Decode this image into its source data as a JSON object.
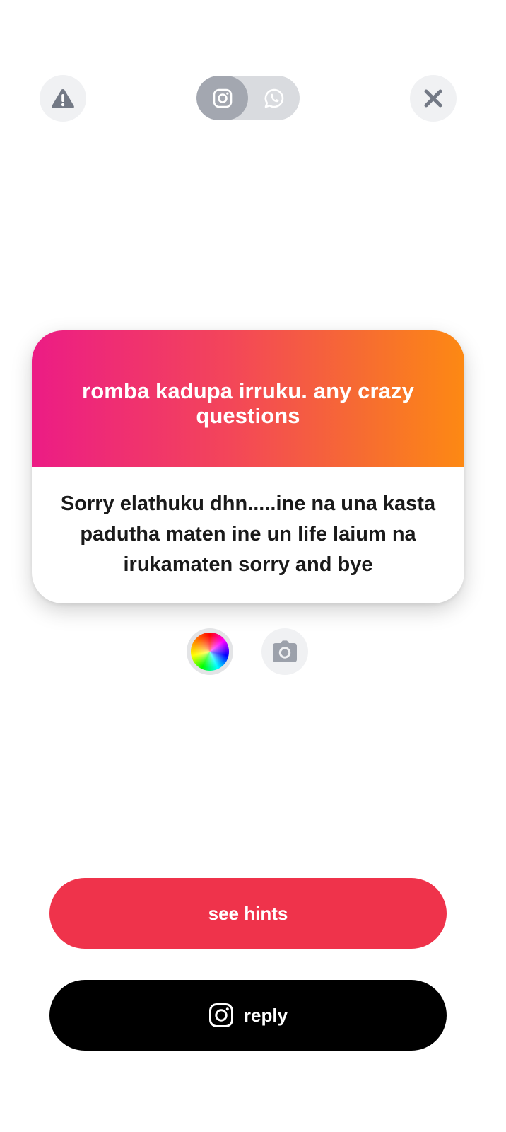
{
  "top_bar": {
    "report_icon": "warning-triangle-icon",
    "close_icon": "close-x-icon",
    "platforms": [
      {
        "name": "instagram",
        "icon": "instagram-icon",
        "selected": true
      },
      {
        "name": "whatsapp",
        "icon": "whatsapp-icon",
        "selected": false
      }
    ]
  },
  "card": {
    "question": "romba kadupa irruku. any crazy questions",
    "answer": "Sorry elathuku dhn.....ine na una kasta padutha maten ine un life laium na irukamaten sorry and bye",
    "gradient_colors": [
      "#ec1c85",
      "#fd8913"
    ]
  },
  "tools": {
    "color_icon": "color-wheel-icon",
    "camera_icon": "camera-icon"
  },
  "buttons": {
    "hints_label": "see hints",
    "hints_color": "#ef334b",
    "reply_label": "reply",
    "reply_icon": "instagram-icon",
    "reply_color": "#000000"
  }
}
